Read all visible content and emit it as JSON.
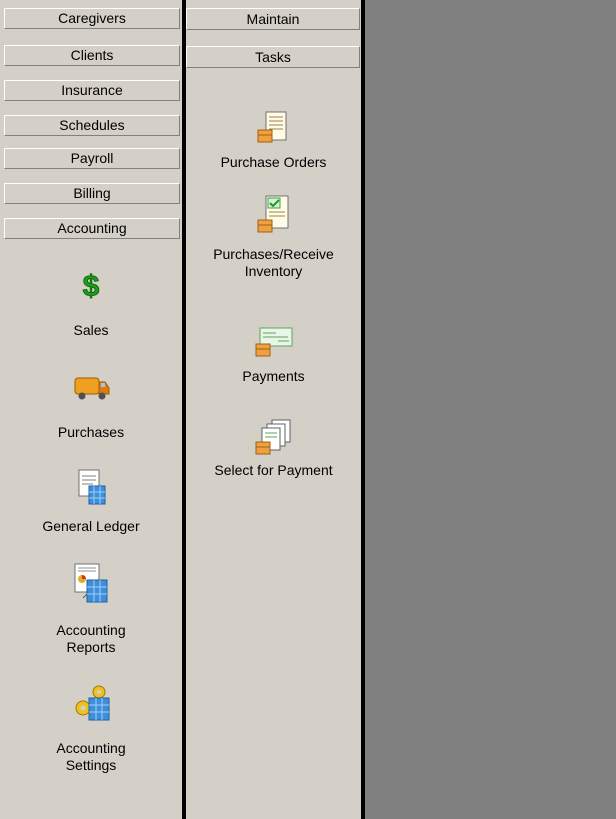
{
  "categories": [
    {
      "label": "Caregivers"
    },
    {
      "label": "Clients"
    },
    {
      "label": "Insurance"
    },
    {
      "label": "Schedules"
    },
    {
      "label": "Payroll"
    },
    {
      "label": "Billing"
    },
    {
      "label": "Accounting"
    }
  ],
  "accounting_items": [
    {
      "line1": "Sales",
      "line2": "",
      "icon": "dollar-sign-icon"
    },
    {
      "line1": "Purchases",
      "line2": "",
      "icon": "delivery-truck-icon"
    },
    {
      "line1": "General Ledger",
      "line2": "",
      "icon": "ledger-document-icon"
    },
    {
      "line1": "Accounting",
      "line2": "Reports",
      "icon": "report-chart-icon"
    },
    {
      "line1": "Accounting",
      "line2": "Settings",
      "icon": "settings-gear-icon"
    }
  ],
  "sub_tabs": {
    "maintain": "Maintain",
    "tasks": "Tasks"
  },
  "task_items": [
    {
      "line1": "Purchase Orders",
      "line2": "",
      "icon": "purchase-order-icon"
    },
    {
      "line1": "Purchases/Receive",
      "line2": "Inventory",
      "icon": "receive-inventory-icon"
    },
    {
      "line1": "Payments",
      "line2": "",
      "icon": "check-payment-icon"
    },
    {
      "line1": "Select for Payment",
      "line2": "",
      "icon": "stacked-checks-icon"
    }
  ],
  "colors": {
    "background": "#d4d0c8",
    "workspace": "#808080",
    "accent_green": "#1a9e1a",
    "accent_orange": "#f0a020"
  }
}
